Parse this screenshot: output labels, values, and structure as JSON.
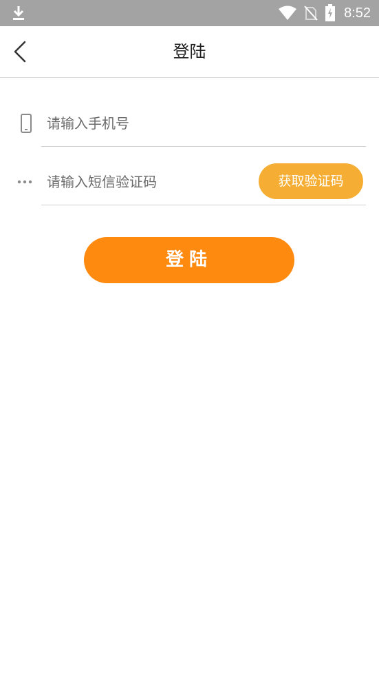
{
  "status_bar": {
    "time": "8:52",
    "icons": [
      "download-icon",
      "wifi-icon",
      "no-sim-icon",
      "battery-charging-icon"
    ]
  },
  "header": {
    "title": "登陆",
    "back_icon": "chevron-left-icon"
  },
  "form": {
    "phone": {
      "icon": "mobile-phone-icon",
      "value": "",
      "placeholder": "请输入手机号"
    },
    "code": {
      "icon": "dots-icon",
      "value": "",
      "placeholder": "请输入短信验证码",
      "get_code_label": "获取验证码"
    }
  },
  "login_button": {
    "label": "登陆"
  },
  "colors": {
    "status_bar_bg": "#a3a3a3",
    "get_code_bg": "#f5ae33",
    "login_bg": "#fe8a10"
  }
}
